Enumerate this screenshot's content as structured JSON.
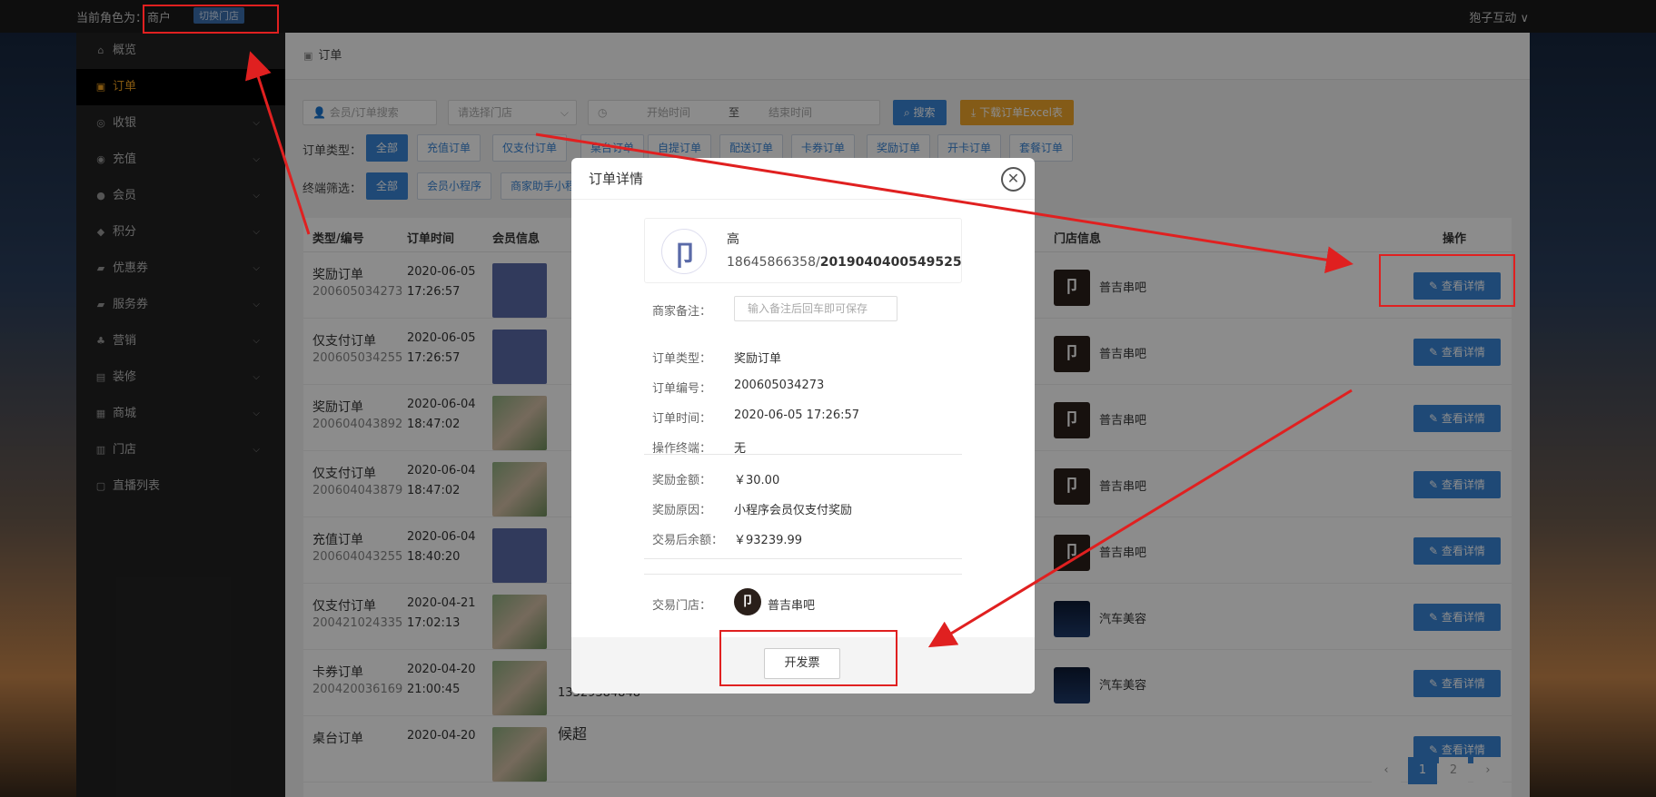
{
  "topbar": {
    "role": "当前角色为：商户",
    "switch": "切换门店",
    "user": "狍子互动 ∨"
  },
  "sidebar": [
    {
      "label": "概览",
      "icon": "home-icon",
      "glyph": "⌂",
      "chev": false
    },
    {
      "label": "订单",
      "icon": "order-icon",
      "glyph": "▣",
      "chev": false,
      "active": true
    },
    {
      "label": "收银",
      "icon": "cashier-icon",
      "glyph": "◎",
      "chev": true
    },
    {
      "label": "充值",
      "icon": "recharge-icon",
      "glyph": "◉",
      "chev": true
    },
    {
      "label": "会员",
      "icon": "member-icon",
      "glyph": "●",
      "chev": true
    },
    {
      "label": "积分",
      "icon": "points-icon",
      "glyph": "◆",
      "chev": true
    },
    {
      "label": "优惠券",
      "icon": "coupon-icon",
      "glyph": "▰",
      "chev": true
    },
    {
      "label": "服务券",
      "icon": "service-coupon-icon",
      "glyph": "▰",
      "chev": true
    },
    {
      "label": "营销",
      "icon": "marketing-icon",
      "glyph": "♣",
      "chev": true
    },
    {
      "label": "装修",
      "icon": "decoration-icon",
      "glyph": "▤",
      "chev": true
    },
    {
      "label": "商城",
      "icon": "mall-icon",
      "glyph": "▦",
      "chev": true
    },
    {
      "label": "门店",
      "icon": "store-icon",
      "glyph": "▥",
      "chev": true
    },
    {
      "label": "直播列表",
      "icon": "live-icon",
      "glyph": "▢",
      "chev": false
    }
  ],
  "breadcrumb": "订单",
  "filters": {
    "search_placeholder": "会员/订单搜索",
    "store_placeholder": "请选择门店",
    "start_placeholder": "开始时间",
    "to": "至",
    "end_placeholder": "结束时间",
    "search_btn": "搜索",
    "excel_btn": "下载订单Excel表",
    "type_label": "订单类型：",
    "types": [
      "全部",
      "充值订单",
      "仅支付订单",
      "桌台订单",
      "自提订单",
      "配送订单",
      "卡券订单",
      "奖励订单",
      "开卡订单",
      "套餐订单"
    ],
    "terminal_label": "终端筛选：",
    "terminals": [
      "全部",
      "会员小程序",
      "商家助手小程"
    ]
  },
  "table": {
    "headers": [
      "类型/编号",
      "订单时间",
      "会员信息",
      "门店信息",
      "操作"
    ],
    "view_label": "查看详情",
    "rows": [
      {
        "type": "奖励订单",
        "num": "200605034273",
        "date": "2020-06-05",
        "time": "17:26:57",
        "avatar": "logo",
        "store": "普吉串吧",
        "slogo": "卩"
      },
      {
        "type": "仅支付订单",
        "num": "200605034255",
        "date": "2020-06-05",
        "time": "17:26:57",
        "avatar": "logo",
        "store": "普吉串吧",
        "slogo": "卩"
      },
      {
        "type": "奖励订单",
        "num": "200604043892",
        "date": "2020-06-04",
        "time": "18:47:02",
        "avatar": "photo",
        "store": "普吉串吧",
        "slogo": "卩"
      },
      {
        "type": "仅支付订单",
        "num": "200604043879",
        "date": "2020-06-04",
        "time": "18:47:02",
        "avatar": "photo",
        "store": "普吉串吧",
        "slogo": "卩"
      },
      {
        "type": "充值订单",
        "num": "200604043255",
        "date": "2020-06-04",
        "time": "18:40:20",
        "avatar": "logo",
        "store": "普吉串吧",
        "slogo": "卩"
      },
      {
        "type": "仅支付订单",
        "num": "200421024335",
        "date": "2020-04-21",
        "time": "17:02:13",
        "avatar": "photo",
        "store": "汽车美容",
        "slogo": "car"
      },
      {
        "type": "卡券订单",
        "num": "200420036169",
        "date": "2020-04-20",
        "time": "21:00:45",
        "avatar": "photo",
        "store": "汽车美容",
        "slogo": "car",
        "extra": "13329384848"
      },
      {
        "type": "桌台订单",
        "num": "",
        "date": "2020-04-20",
        "time": "",
        "avatar": "photo",
        "store": "",
        "slogo": "",
        "extra": "候超"
      }
    ]
  },
  "pager": {
    "prev": "‹",
    "pages": [
      "1",
      "2"
    ],
    "next": "›"
  },
  "modal": {
    "title": "订单详情",
    "close": "✕",
    "member_name": "高",
    "member_phone": "18645866358/",
    "member_card": "2019040400549525",
    "note_label": "商家备注：",
    "note_placeholder": "输入备注后回车即可保存",
    "fields": [
      {
        "label": "订单类型：",
        "value": "奖励订单"
      },
      {
        "label": "订单编号：",
        "value": "200605034273"
      },
      {
        "label": "订单时间：",
        "value": "2020-06-05 17:26:57"
      },
      {
        "label": "操作终端：",
        "value": "无"
      }
    ],
    "fields2": [
      {
        "label": "奖励金额：",
        "value": "￥30.00"
      },
      {
        "label": "奖励原因：",
        "value": "小程序会员仅支付奖励"
      },
      {
        "label": "交易后余额：",
        "value": "￥93239.99"
      }
    ],
    "store_label": "交易门店：",
    "store_name": "普吉串吧",
    "store_logo": "卩",
    "invoice_btn": "开发票"
  }
}
